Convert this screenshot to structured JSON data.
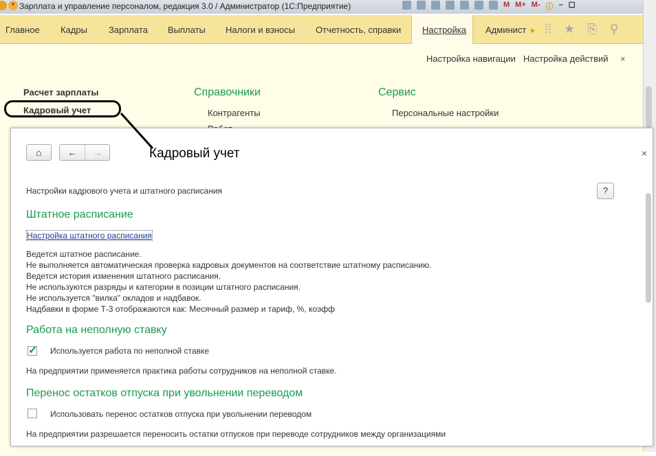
{
  "window": {
    "title": "Зарплата и управление персоналом, редакция 3.0 / Администратор  (1С:Предприятие)",
    "tool_labels": [
      "M",
      "M+",
      "M-"
    ]
  },
  "nav": {
    "items": [
      "Главное",
      "Кадры",
      "Зарплата",
      "Выплаты",
      "Налоги и взносы",
      "Отчетность, справки",
      "Настройка",
      "Админист"
    ],
    "active": "Настройка"
  },
  "panel": {
    "nav_settings": "Настройка навигации",
    "action_settings": "Настройка действий",
    "close": "×",
    "col1": [
      "Расчет зарплаты",
      "Кадровый учет"
    ],
    "col2_title": "Справочники",
    "col2": [
      "Контрагенты",
      "Работ"
    ],
    "col3_title": "Сервис",
    "col3": [
      "Персональные настройки"
    ]
  },
  "dialog": {
    "title": "Кадровый учет",
    "close": "×",
    "subtitle": "Настройки кадрового учета и штатного расписания",
    "help": "?",
    "sec1": {
      "title": "Штатное расписание",
      "link": "Настройка штатного расписания",
      "lines": [
        "Ведется штатное расписание.",
        "Не выполняется автоматическая проверка кадровых документов на соответствие штатному расписанию.",
        "Ведется история изменения штатного расписания.",
        "Не используются разряды и категории в позиции штатного расписания.",
        "Не используется \"вилка\" окладов и надбавок.",
        "Надбавки в форме Т-3 отображаются как: Месячный размер и тариф, %, коэфф"
      ]
    },
    "sec2": {
      "title": "Работа на неполную ставку",
      "checkbox": "Используется работа по неполной ставке",
      "checked": true,
      "note": "На предприятии применяется практика работы сотрудников на неполной ставке."
    },
    "sec3": {
      "title": "Перенос остатков отпуска при увольнении переводом",
      "checkbox": "Использовать перенос остатков отпуска при увольнении переводом",
      "checked": false,
      "note": "На предприятии разрешается переносить остатки отпусков при переводе сотрудников между организациями"
    }
  }
}
